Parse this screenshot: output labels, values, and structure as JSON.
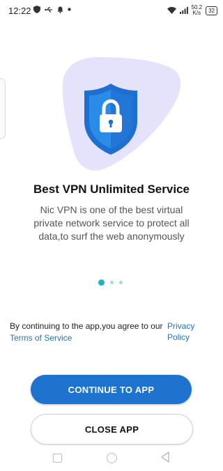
{
  "status_bar": {
    "time": "12:22",
    "net_speed_value": "50.2",
    "net_speed_unit": "K/s",
    "battery": "32"
  },
  "onboarding": {
    "title": "Best VPN Unlimited Service",
    "description": "Nic VPN is one of the best virtual private network service to protect all data,to surf the web anonymously",
    "page_indicator": {
      "current": 1,
      "total": 3
    }
  },
  "consent": {
    "text": "By continuing to the app,you agree to our",
    "privacy_link": "Privacy Policy",
    "terms_link": "Terms of Service"
  },
  "buttons": {
    "continue_label": "CONTINUE TO APP",
    "close_label": "CLOSE APP"
  },
  "colors": {
    "primary": "#1e73cf",
    "link": "#1e73c9",
    "dot_active": "#1fb1c7",
    "hero_blob": "#e5e2fb",
    "shield": "#1f6fd1"
  },
  "icons": [
    "shield-lock-icon",
    "wifi-icon",
    "signal-icon",
    "battery-icon"
  ]
}
